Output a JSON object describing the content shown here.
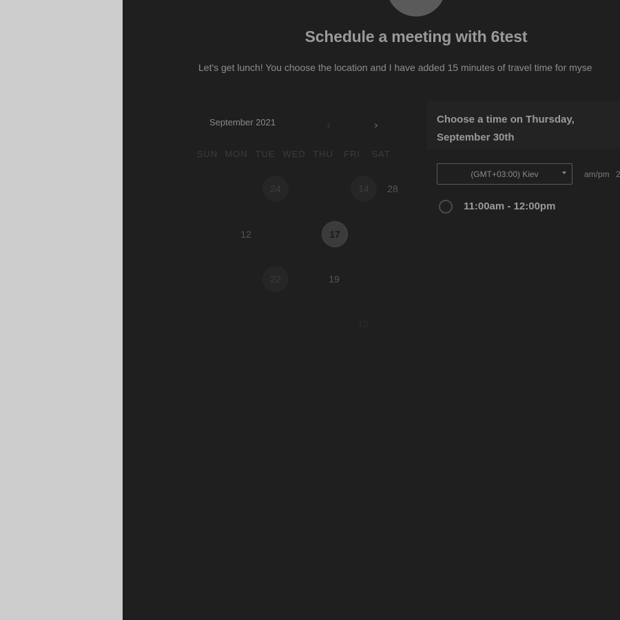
{
  "header": {
    "title": "Schedule a meeting with 6test",
    "description": "Let's get lunch! You choose the location and I have added 15 minutes of travel time for myse"
  },
  "calendar": {
    "month_label": "September 2021",
    "prev_icon": "chevron-left-icon",
    "next_icon": "chevron-right-icon",
    "weekdays": [
      "SUN",
      "MON",
      "TUE",
      "WED",
      "THU",
      "FRI",
      "SAT"
    ],
    "weeks": [
      [
        "",
        "",
        "24",
        "",
        "",
        "14",
        "28"
      ],
      [
        "",
        "12",
        "",
        "",
        "17",
        "",
        ""
      ],
      [
        "",
        "",
        "22",
        "",
        "19",
        "",
        ""
      ],
      [
        "",
        "",
        "",
        "",
        "",
        "12",
        ""
      ],
      [
        "",
        "",
        "",
        "",
        "",
        "",
        ""
      ]
    ],
    "selected_day": "17"
  },
  "time_panel": {
    "heading": "Choose a time on Thursday, September 30th",
    "timezone": "(GMT+03:00) Kiev",
    "format_label": "am/pm",
    "format_suffix": "2",
    "slots": [
      {
        "label": "11:00am - 12:00pm",
        "selected": false
      }
    ]
  }
}
